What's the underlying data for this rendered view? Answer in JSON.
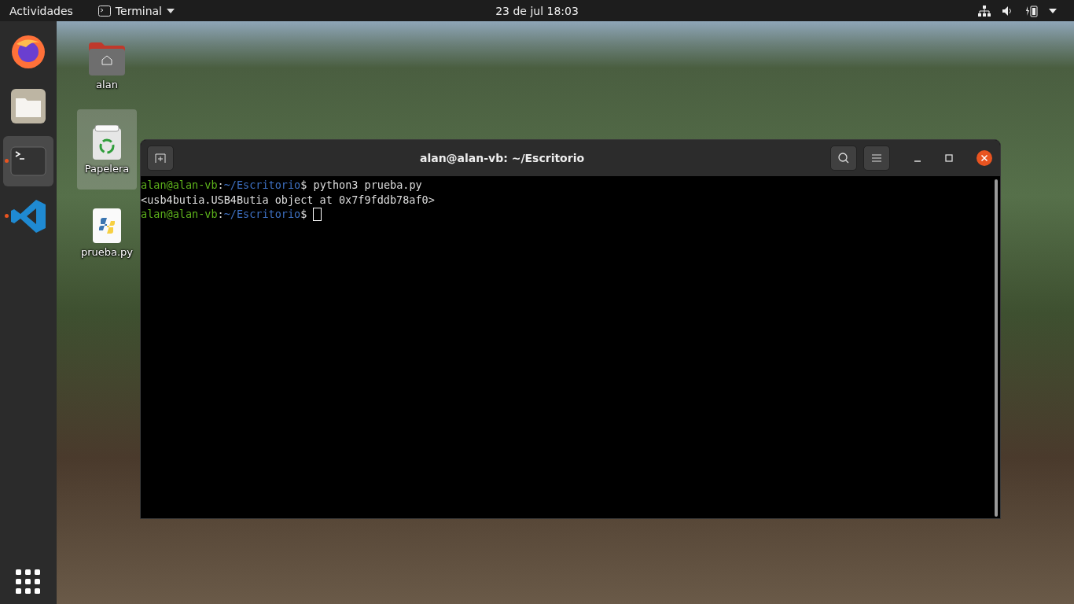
{
  "top_bar": {
    "activities": "Actividades",
    "app_menu": "Terminal",
    "clock": "23 de jul  18:03"
  },
  "dock": {
    "items": [
      {
        "kind": "firefox",
        "running": false,
        "selected": false
      },
      {
        "kind": "files",
        "running": false,
        "selected": false
      },
      {
        "kind": "terminal",
        "running": true,
        "selected": true
      },
      {
        "kind": "vscode",
        "running": true,
        "selected": false
      }
    ]
  },
  "desktop_icons": [
    {
      "kind": "home",
      "label": "alan",
      "selected": false
    },
    {
      "kind": "trash",
      "label": "Papelera",
      "selected": true
    },
    {
      "kind": "python",
      "label": "prueba.py",
      "selected": false
    }
  ],
  "terminal": {
    "title": "alan@alan-vb: ~/Escritorio",
    "lines": [
      {
        "kind": "prompt",
        "user": "alan@alan-vb",
        "sep": ":",
        "path": "~/Escritorio",
        "symbol": "$",
        "command": " python3 prueba.py"
      },
      {
        "kind": "output",
        "text": "<usb4butia.USB4Butia object at 0x7f9fddb78af0>"
      },
      {
        "kind": "prompt",
        "user": "alan@alan-vb",
        "sep": ":",
        "path": "~/Escritorio",
        "symbol": "$",
        "cursor": true
      }
    ]
  }
}
